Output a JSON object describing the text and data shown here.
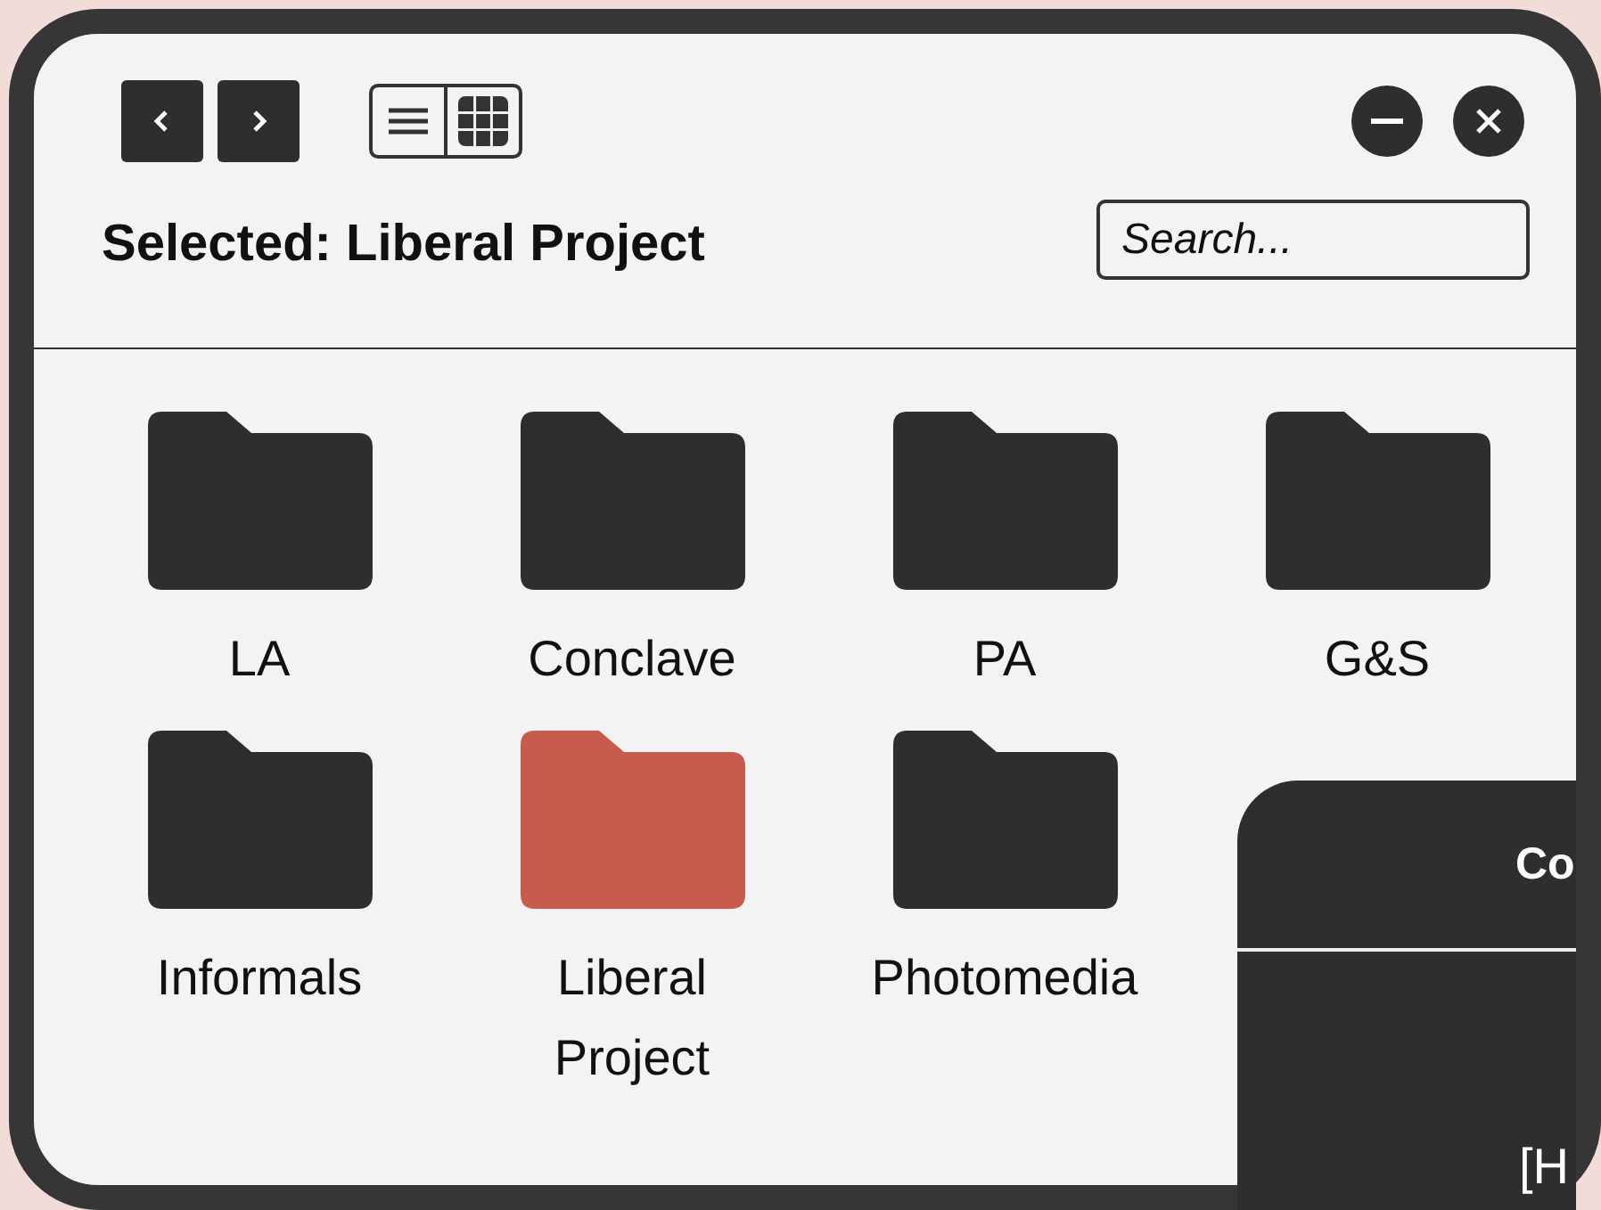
{
  "window": {
    "title": "Selected: Liberal Project",
    "search": {
      "placeholder": "Search..."
    }
  },
  "folders": [
    {
      "name": "LA",
      "selected": false
    },
    {
      "name": "Conclave",
      "selected": false
    },
    {
      "name": "PA",
      "selected": false
    },
    {
      "name": "G&S",
      "selected": false
    },
    {
      "name": "Informals",
      "selected": false
    },
    {
      "name": "Liberal Project",
      "selected": true
    },
    {
      "name": "Photomedia",
      "selected": false
    }
  ],
  "overlay_panel": {
    "heading": "Co",
    "text": "[H"
  }
}
